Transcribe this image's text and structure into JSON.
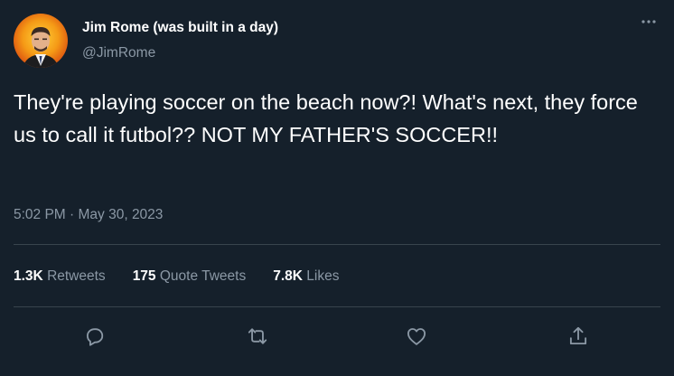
{
  "author": {
    "display_name": "Jim Rome (was built in a day)",
    "handle": "@JimRome"
  },
  "tweet": {
    "text": "They're playing soccer on the beach now?! What's next, they force us to call it futbol?? NOT MY FATHER'S SOCCER!!",
    "timestamp": "5:02 PM · May 30, 2023"
  },
  "stats": {
    "retweets_count": "1.3K",
    "retweets_label": "Retweets",
    "quote_tweets_count": "175",
    "quote_tweets_label": "Quote Tweets",
    "likes_count": "7.8K",
    "likes_label": "Likes"
  },
  "actions": {
    "icons": [
      "reply-icon",
      "retweet-icon",
      "like-icon",
      "share-icon"
    ]
  },
  "colors": {
    "background": "#15202b",
    "primary_text": "#ffffff",
    "secondary_text": "#8b98a5",
    "divider": "#38444d"
  }
}
